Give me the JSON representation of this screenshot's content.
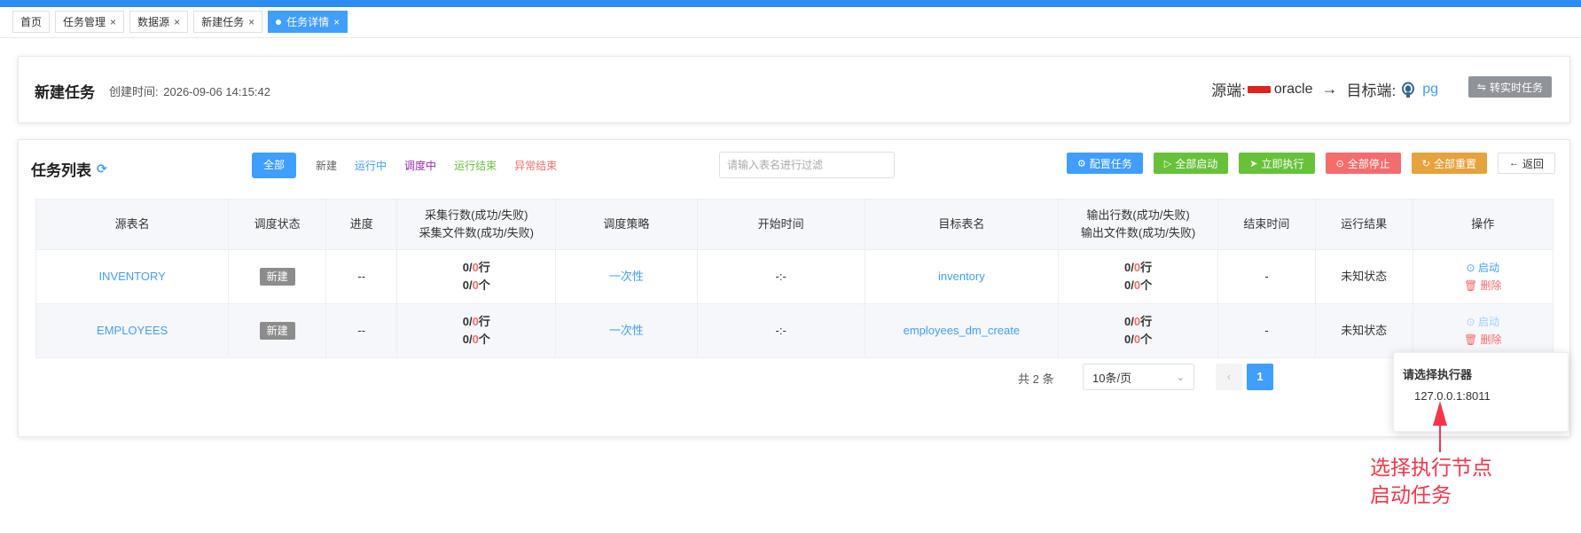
{
  "tabs": [
    {
      "label": "首页",
      "closable": false,
      "active": false
    },
    {
      "label": "任务管理",
      "closable": true,
      "active": false
    },
    {
      "label": "数据源",
      "closable": true,
      "active": false
    },
    {
      "label": "新建任务",
      "closable": true,
      "active": false
    },
    {
      "label": "任务详情",
      "closable": true,
      "active": true
    }
  ],
  "close_glyph": "×",
  "header": {
    "title": "新建任务",
    "created_label": "创建时间:",
    "created_value": "2026-09-06 14:15:42",
    "source_label": "源端:",
    "source_name": "oracle",
    "arrow": "→",
    "target_label": "目标端:",
    "target_name": "pg",
    "realtime_button": "转实时任务"
  },
  "task_list": {
    "title": "任务列表",
    "filter_tabs": [
      {
        "label": "全部",
        "color": "#ffffff",
        "selected": true
      },
      {
        "label": "新建",
        "color": "#606266",
        "selected": false
      },
      {
        "label": "运行中",
        "color": "#409eff",
        "selected": false
      },
      {
        "label": "调度中",
        "color": "#9b27b0",
        "selected": false
      },
      {
        "label": "运行结束",
        "color": "#67c23a",
        "selected": false
      },
      {
        "label": "异常结束",
        "color": "#f56c6c",
        "selected": false
      }
    ],
    "filter_placeholder": "请输入表名进行过滤",
    "actions": {
      "config": "配置任务",
      "start_all": "全部启动",
      "run_now": "立即执行",
      "stop_all": "全部停止",
      "reset_all": "全部重置",
      "back": "返回"
    },
    "columns": {
      "source_table": "源表名",
      "schedule_status": "调度状态",
      "progress": "进度",
      "collect_rows": "采集行数(成功/失败)",
      "collect_files": "采集文件数(成功/失败)",
      "schedule_strategy": "调度策略",
      "start_time": "开始时间",
      "target_table": "目标表名",
      "output_rows": "输出行数(成功/失败)",
      "output_files": "输出文件数(成功/失败)",
      "end_time": "结束时间",
      "run_result": "运行结果",
      "operation": "操作"
    },
    "rows": [
      {
        "source_table": "INVENTORY",
        "status": "新建",
        "progress": "--",
        "collect_ok": "0",
        "collect_fail": "0",
        "row_unit": "行",
        "file_ok": "0",
        "file_fail": "0",
        "file_unit": "个",
        "strategy": "一次性",
        "start_time": "-:-",
        "target_table": "inventory",
        "out_ok": "0",
        "out_fail": "0",
        "out_file_ok": "0",
        "out_file_fail": "0",
        "end_time": "-",
        "result": "未知状态",
        "op_start": "启动",
        "op_delete": "删除"
      },
      {
        "source_table": "EMPLOYEES",
        "status": "新建",
        "progress": "--",
        "collect_ok": "0",
        "collect_fail": "0",
        "row_unit": "行",
        "file_ok": "0",
        "file_fail": "0",
        "file_unit": "个",
        "strategy": "一次性",
        "start_time": "-:-",
        "target_table": "employees_dm_create",
        "out_ok": "0",
        "out_fail": "0",
        "out_file_ok": "0",
        "out_file_fail": "0",
        "end_time": "-",
        "result": "未知状态",
        "op_start": "启动",
        "op_delete": "删除"
      }
    ],
    "pagination": {
      "total": "共 2 条",
      "page_size": "10条/页",
      "prev": "‹",
      "current_page": "1"
    }
  },
  "popover": {
    "title": "请选择执行器",
    "option": "127.0.0.1:8011"
  },
  "annotation": {
    "line1": "选择执行节点",
    "line2": "启动任务",
    "color": "#f5364b"
  }
}
